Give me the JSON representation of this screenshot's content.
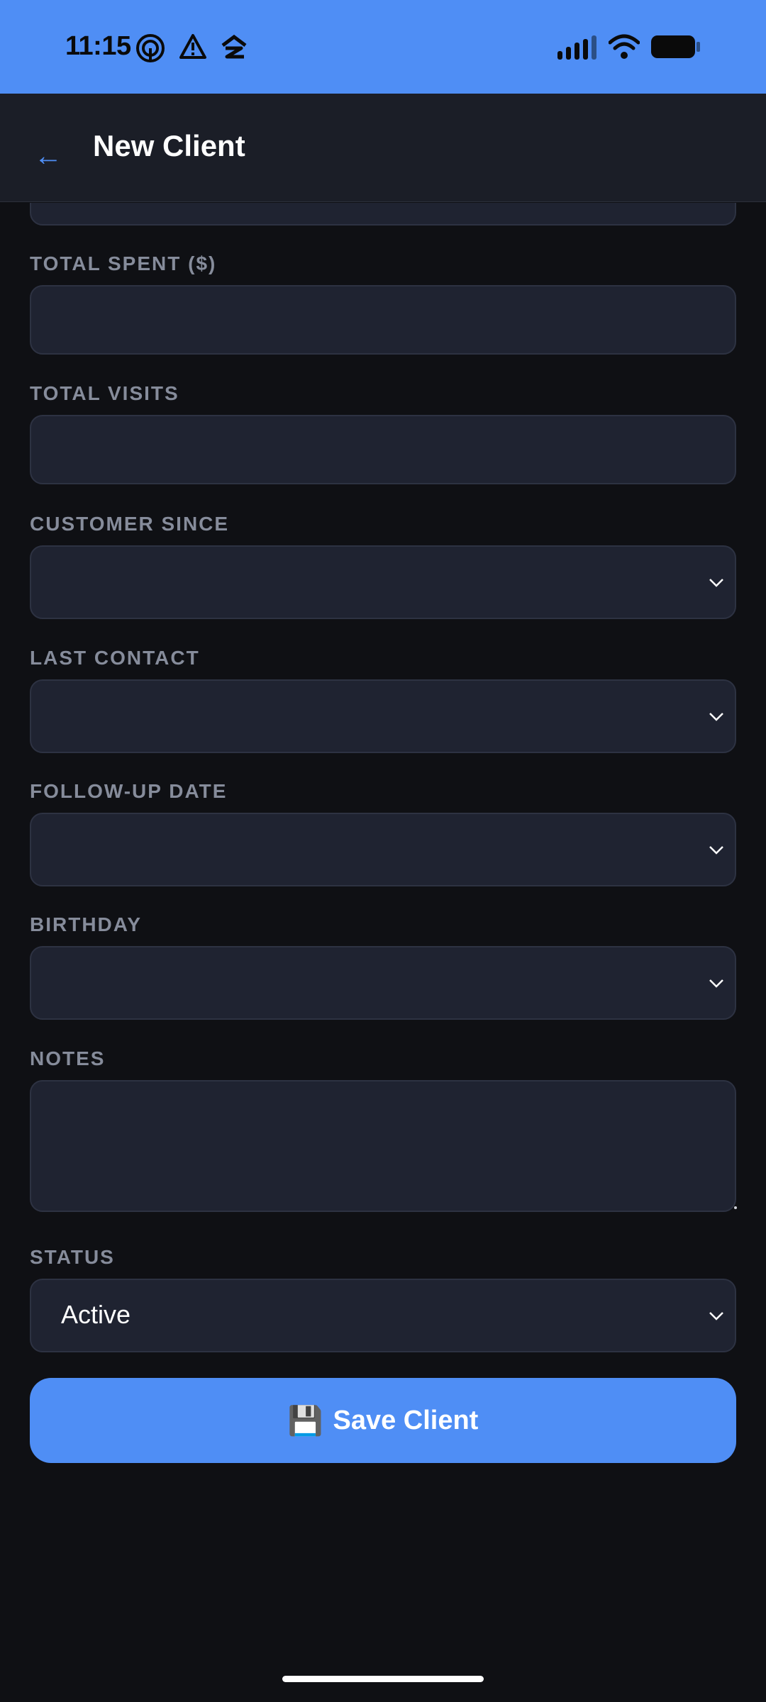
{
  "status_bar": {
    "time": "11:15",
    "icons": [
      "hotspot-icon",
      "warning-icon",
      "zillow-icon",
      "signal-icon",
      "wifi-icon",
      "battery-icon"
    ]
  },
  "header": {
    "back_icon": "←",
    "title": "New Client"
  },
  "form": {
    "fields": [
      {
        "label": "TOTAL SPENT ($)",
        "value": "",
        "type": "number"
      },
      {
        "label": "TOTAL VISITS",
        "value": "",
        "type": "number"
      },
      {
        "label": "CUSTOMER SINCE",
        "value": "",
        "type": "date"
      },
      {
        "label": "LAST CONTACT",
        "value": "",
        "type": "date"
      },
      {
        "label": "FOLLOW-UP DATE",
        "value": "",
        "type": "date"
      },
      {
        "label": "BIRTHDAY",
        "value": "",
        "type": "date"
      },
      {
        "label": "NOTES",
        "value": "",
        "type": "textarea"
      },
      {
        "label": "STATUS",
        "value": "Active",
        "type": "select"
      }
    ],
    "save_icon": "💾",
    "save_label": "Save Client"
  },
  "colors": {
    "accent": "#4f8ef5",
    "background": "#0f1014",
    "header_bg": "#1b1e27",
    "field_bg": "#1f2331",
    "label": "#868c9b"
  }
}
